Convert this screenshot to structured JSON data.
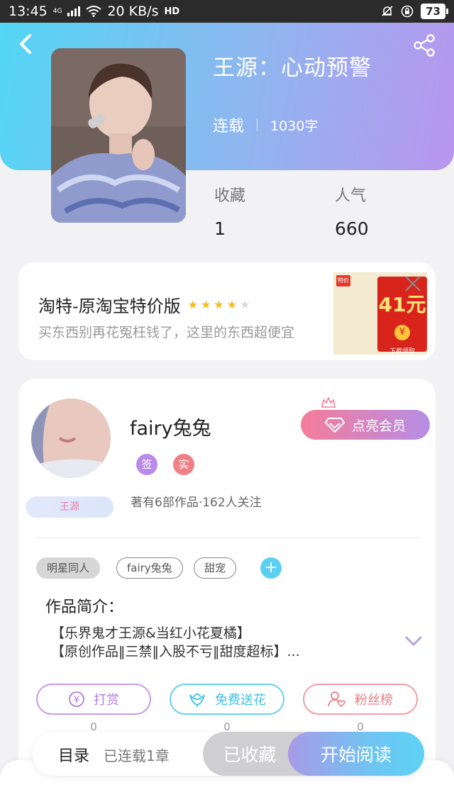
{
  "status_bar": {
    "time": "13:45",
    "network": "4G",
    "speed": "20 KB/s",
    "hd": "HD",
    "battery": "73"
  },
  "header": {
    "title": "王源：心动预警",
    "status": "连载",
    "word_count": "1030字"
  },
  "stats": {
    "collect_label": "收藏",
    "collect_value": "1",
    "popularity_label": "人气",
    "popularity_value": "660"
  },
  "ad": {
    "title": "淘特-原淘宝特价版",
    "rating": 4,
    "description": "买东西别再花冤枉钱了，这里的东西超便宜",
    "logo_text": "特价",
    "amount": "41元",
    "coin": "¥",
    "cta": "下载领取"
  },
  "author": {
    "name": "fairy兔兔",
    "badge_sign": "签",
    "badge_real": "实",
    "stats_text": "著有6部作品·162人关注",
    "fan_badge": "王源",
    "vip_button": "点亮会员"
  },
  "tags": [
    "明星同人",
    "fairy兔兔",
    "甜宠"
  ],
  "intro": {
    "title": "作品简介：",
    "line1": "【乐界鬼才王源&当红小花夏橘】",
    "line2": "【原创作品‖三禁‖入股不亏‖甜度超标】..."
  },
  "actions": [
    {
      "label": "打赏",
      "count": "0",
      "icon": "yuan-coin-icon",
      "color": "#b27fdc"
    },
    {
      "label": "免费送花",
      "count": "0",
      "icon": "flower-icon",
      "color": "#3ec2e4"
    },
    {
      "label": "粉丝榜",
      "count": "0",
      "icon": "fan-heart-icon",
      "color": "#ea7e89"
    }
  ],
  "bottom_bar": {
    "toc": "目录",
    "toc_sub": "已连载1章",
    "collected": "已收藏",
    "start_reading": "开始阅读"
  },
  "colors": {
    "header_gradient_start": "#53d6f4",
    "header_gradient_end": "#b996ee",
    "vip_gradient_start": "#f57c99",
    "vip_gradient_end": "#b58ee6",
    "star_on": "#f5b921"
  }
}
